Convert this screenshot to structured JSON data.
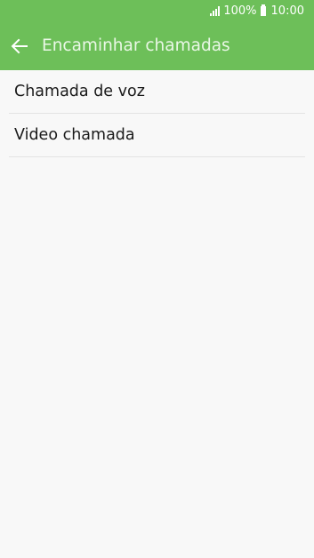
{
  "status_bar": {
    "battery": "100%",
    "time": "10:00",
    "signal_icon": "signal-icon",
    "battery_icon": "battery-icon"
  },
  "app_bar": {
    "back_icon": "arrow-left-icon",
    "title": "Encaminhar chamadas"
  },
  "list": {
    "items": [
      {
        "label": "Chamada de voz"
      },
      {
        "label": "Video chamada"
      }
    ]
  },
  "colors": {
    "accent": "#6dbf59",
    "background": "#f8f8f8",
    "title_text": "#eaf7e6",
    "item_text": "#1a1a1a",
    "divider": "#e3e3e3"
  }
}
